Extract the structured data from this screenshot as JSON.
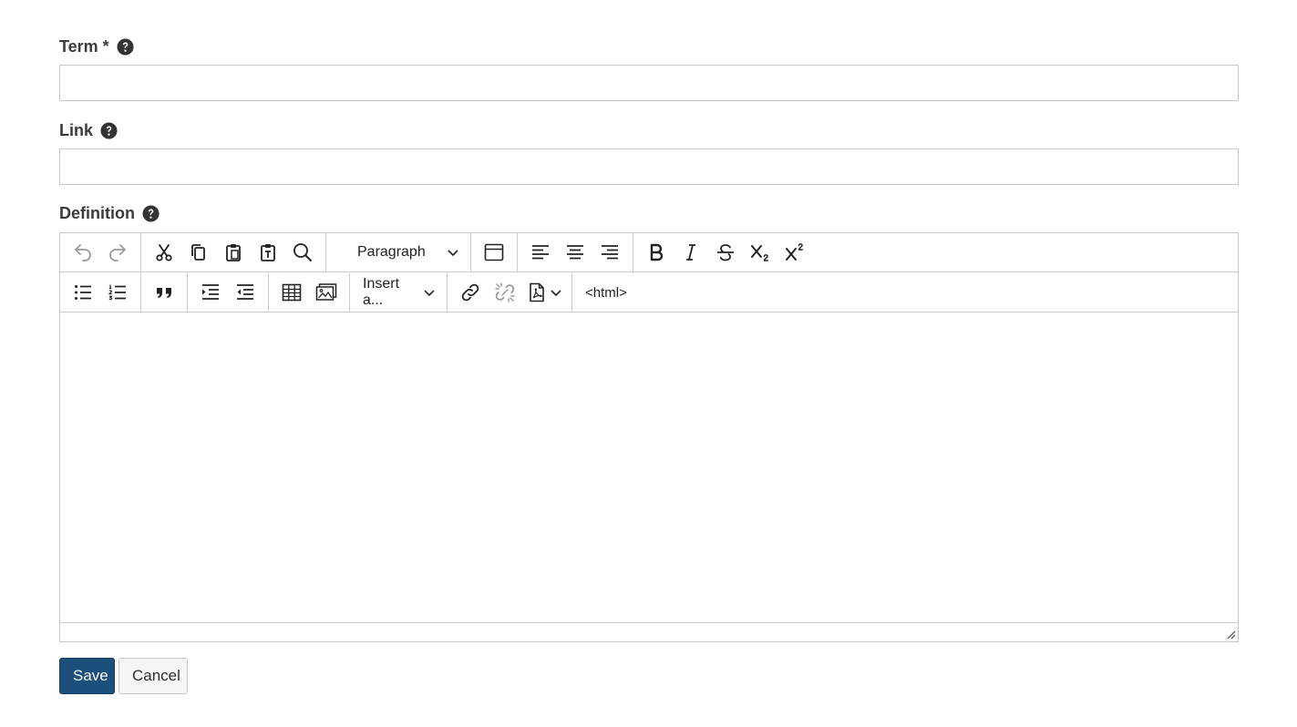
{
  "form": {
    "term": {
      "label": "Term *",
      "value": "",
      "help_icon": "question-circle-icon"
    },
    "link": {
      "label": "Link",
      "value": "",
      "help_icon": "question-circle-icon"
    },
    "definition": {
      "label": "Definition",
      "help_icon": "question-circle-icon",
      "toolbar": {
        "block_format": "Paragraph",
        "insert_menu": "Insert a...",
        "html_button": "<html>"
      },
      "content": ""
    }
  },
  "actions": {
    "save_label": "Save",
    "cancel_label": "Cancel"
  },
  "colors": {
    "primary": "#1d4f7c",
    "border": "#c6c6c6",
    "text": "#333333"
  }
}
